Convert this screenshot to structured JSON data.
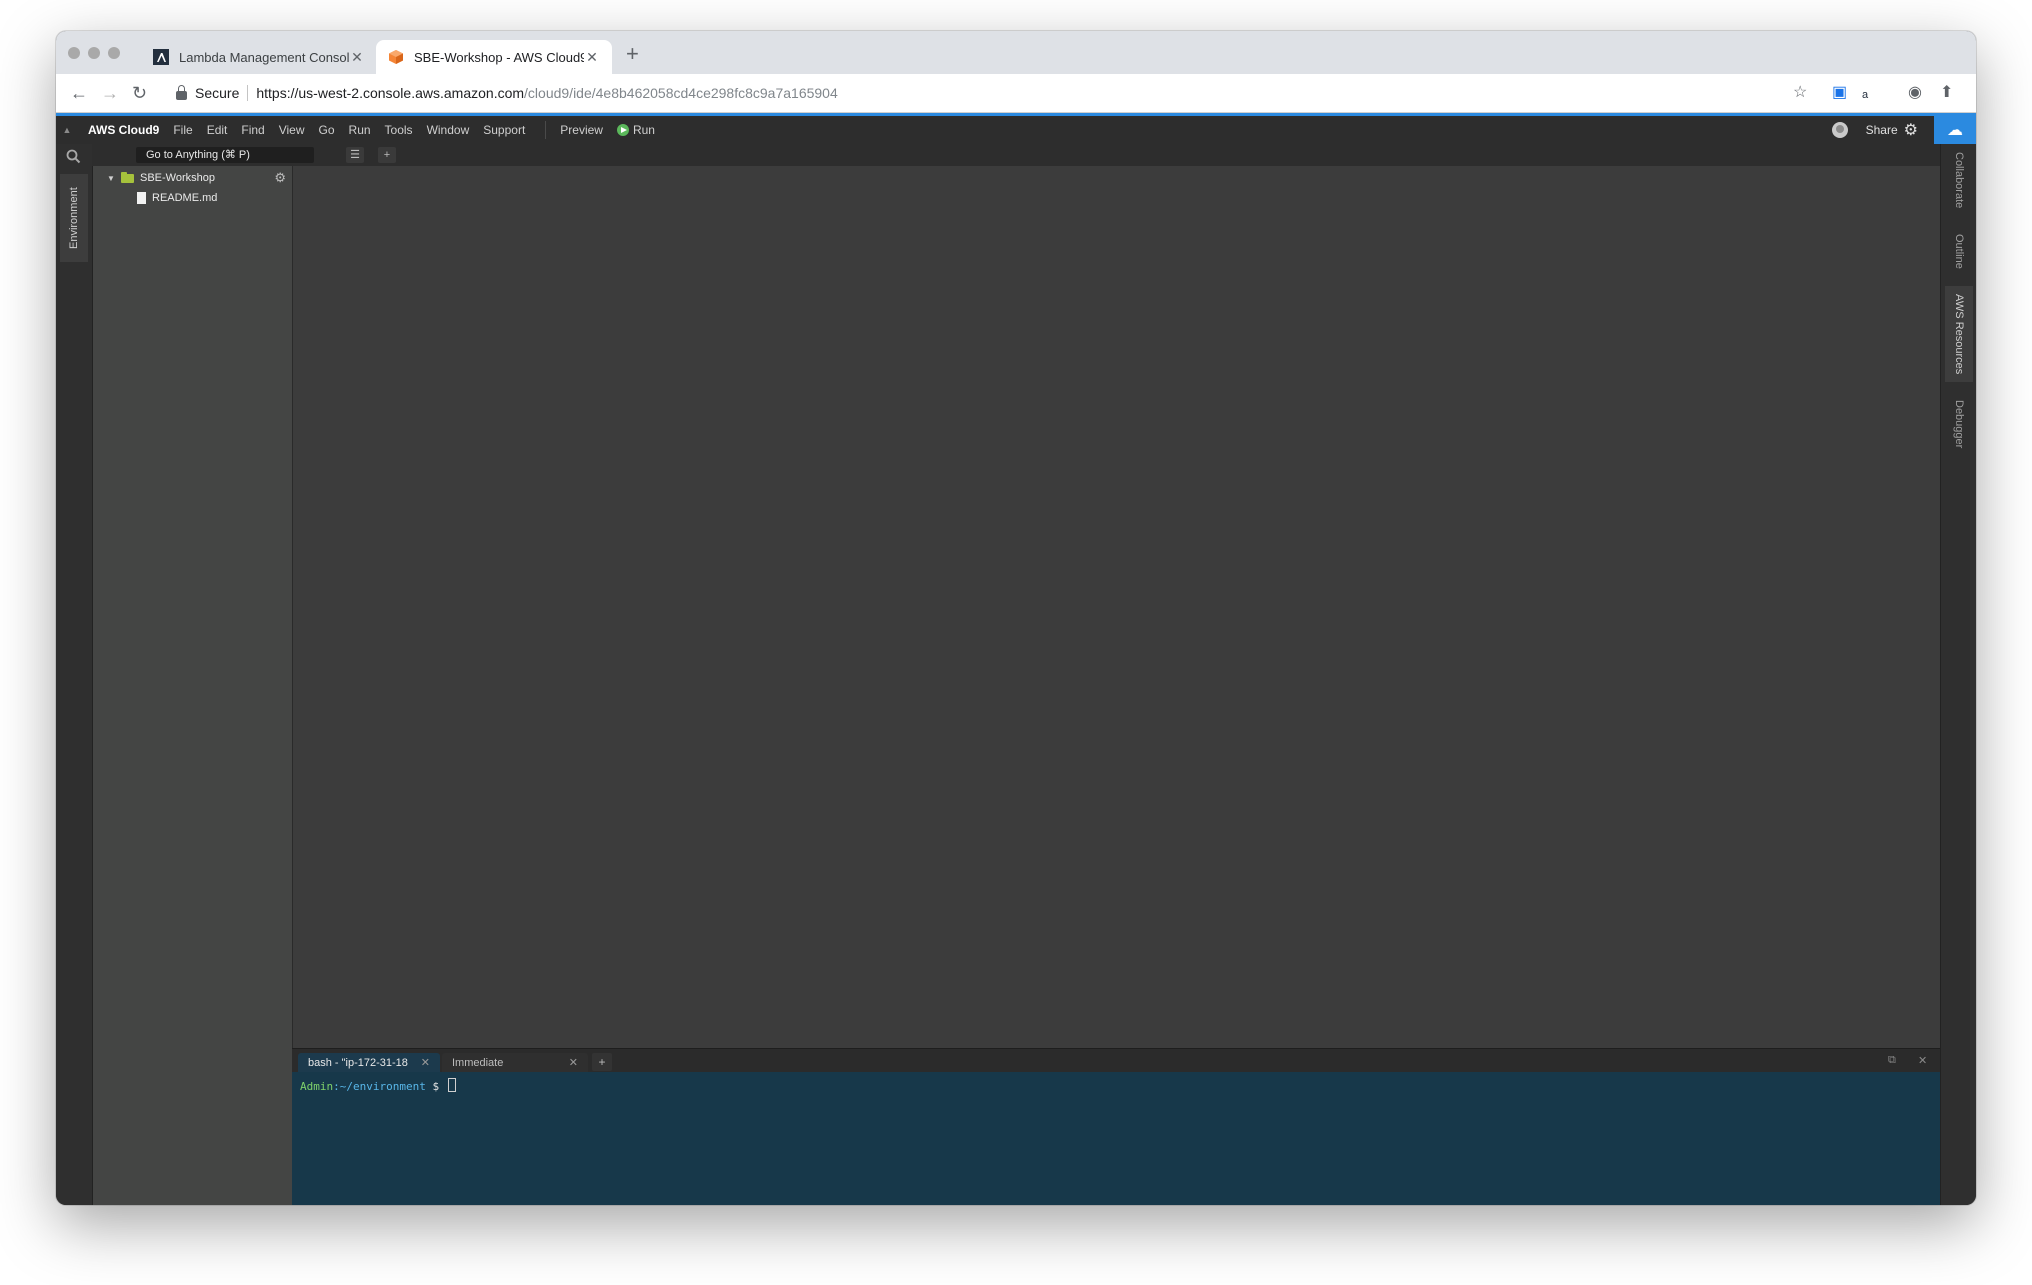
{
  "browser": {
    "tabs": [
      {
        "title": "Lambda Management Console",
        "active": false,
        "icon": "lambda-icon"
      },
      {
        "title": "SBE-Workshop - AWS Cloud9",
        "active": true,
        "icon": "cloud9-cube-icon"
      }
    ],
    "secure_label": "Secure",
    "url_host": "https://us-west-2.console.aws.amazon.com",
    "url_path": "/cloud9/ide/4e8b462058cd4ce298fc8c9a7a165904"
  },
  "ide": {
    "brand": "AWS Cloud9",
    "menu": [
      "File",
      "Edit",
      "Find",
      "View",
      "Go",
      "Run",
      "Tools",
      "Window",
      "Support"
    ],
    "preview_label": "Preview",
    "run_label": "Run",
    "share_label": "Share",
    "goto_placeholder": "Go to Anything (⌘ P)",
    "left_panel_tab": "Environment",
    "tree": {
      "root": "SBE-Workshop",
      "files": [
        "README.md"
      ]
    },
    "right_panel_tabs": [
      "Collaborate",
      "Outline",
      "AWS Resources",
      "Debugger"
    ],
    "terminal": {
      "tabs": [
        {
          "label": "bash - \"ip-172-31-18",
          "active": true
        },
        {
          "label": "Immediate",
          "active": false
        }
      ],
      "prompt_user": "Admin",
      "prompt_path": ":~/environment",
      "prompt_symbol": " $ "
    }
  },
  "colors": {
    "accent_blue": "#2b8ae0",
    "run_green": "#5bb85b",
    "folder_green": "#a6c23c",
    "terminal_bg": "#17384a"
  }
}
